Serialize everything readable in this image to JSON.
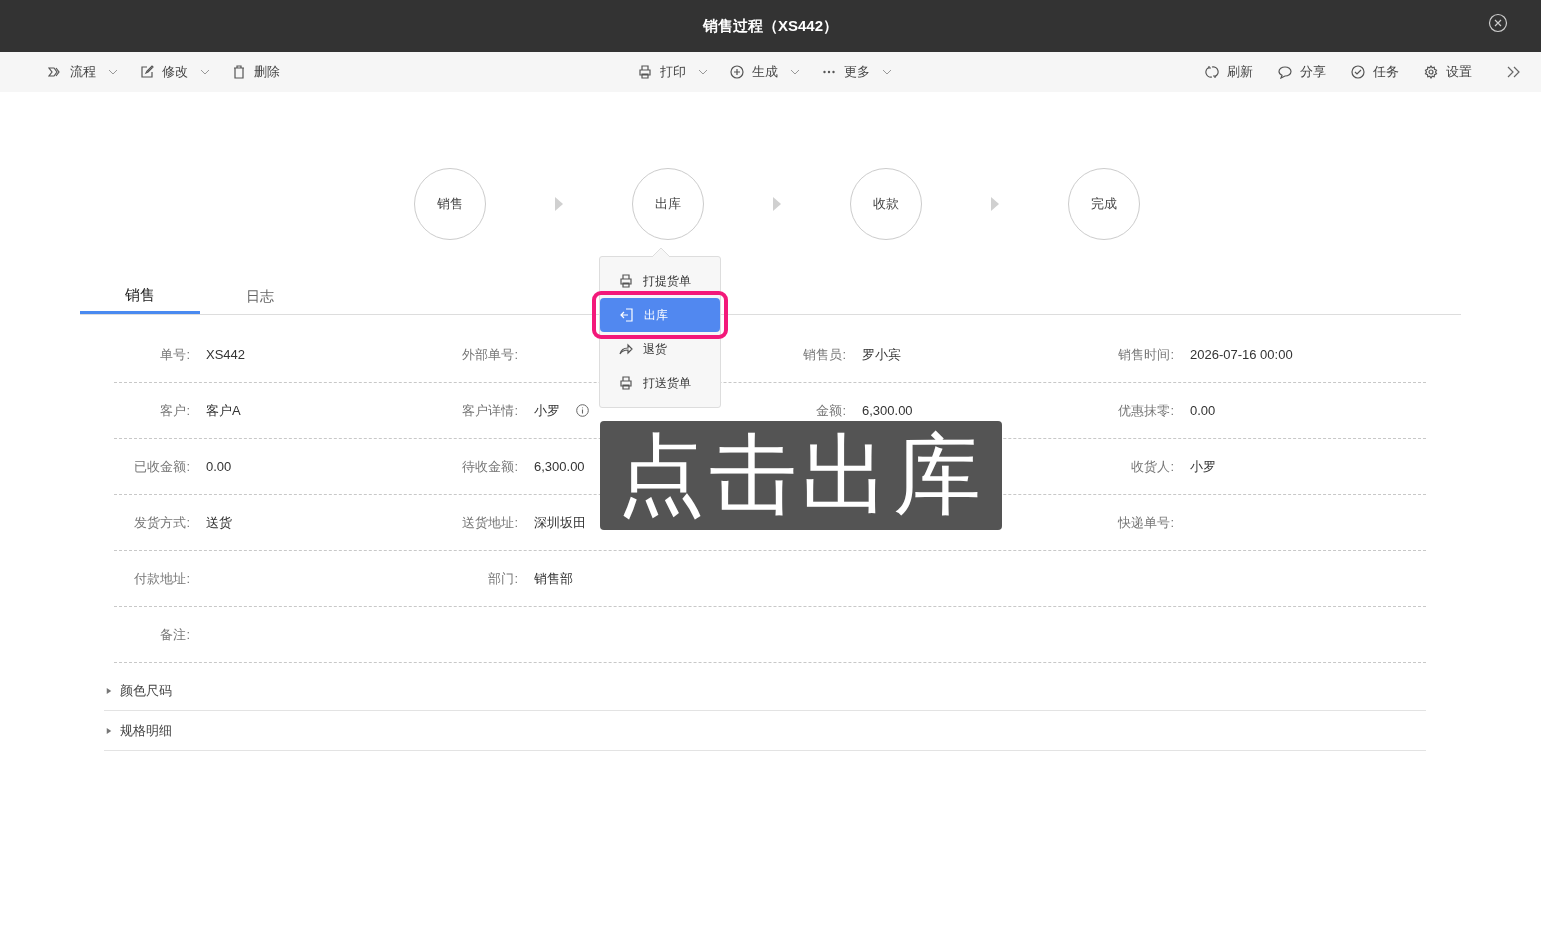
{
  "window": {
    "title": "销售过程（XS442）"
  },
  "toolbar": {
    "left": [
      {
        "kind": "flow",
        "label": "流程",
        "dropdown": true
      },
      {
        "kind": "edit",
        "label": "修改",
        "dropdown": true
      },
      {
        "kind": "trash",
        "label": "删除",
        "dropdown": false
      }
    ],
    "center": [
      {
        "kind": "print",
        "label": "打印",
        "dropdown": true
      },
      {
        "kind": "plus",
        "label": "生成",
        "dropdown": true
      },
      {
        "kind": "more",
        "label": "更多",
        "dropdown": true
      }
    ],
    "right": [
      {
        "kind": "refresh",
        "label": "刷新",
        "dropdown": false
      },
      {
        "kind": "comment",
        "label": "分享",
        "dropdown": false
      },
      {
        "kind": "check",
        "label": "任务",
        "dropdown": false
      },
      {
        "kind": "gear",
        "label": "设置",
        "dropdown": false
      }
    ]
  },
  "steps": [
    {
      "label": "销售"
    },
    {
      "label": "出库"
    },
    {
      "label": "收款"
    },
    {
      "label": "完成"
    }
  ],
  "step_menu": {
    "items": [
      {
        "kind": "print",
        "label": "打提货单",
        "selected": false
      },
      {
        "kind": "enter",
        "label": "出库",
        "selected": true
      },
      {
        "kind": "share",
        "label": "退货",
        "selected": false
      },
      {
        "kind": "print",
        "label": "打送货单",
        "selected": false
      }
    ]
  },
  "tabs": [
    {
      "label": "销售",
      "selected": true
    },
    {
      "label": "日志",
      "selected": false
    }
  ],
  "form_columns": [
    [
      {
        "label": "单号:",
        "value": "XS442"
      },
      {
        "label": "客户:",
        "value": "客户A"
      },
      {
        "label": "已收金额:",
        "value": "0.00"
      },
      {
        "label": "发货方式:",
        "value": "送货"
      },
      {
        "label": "付款地址:"
      },
      {
        "label": "备注:"
      }
    ],
    [
      {
        "label": "外部单号:"
      },
      {
        "label": "客户详情:",
        "value": "小罗",
        "info": true
      },
      {
        "label": "待收金额:",
        "value": "6,300.00"
      },
      {
        "label": "送货地址:",
        "value": "深圳坂田"
      },
      {
        "label": "部门:",
        "value": "销售部"
      }
    ],
    [
      {
        "label": "销售员:",
        "value": "罗小宾"
      },
      {
        "label": "金额:",
        "value": "6,300.00"
      }
    ],
    [
      {
        "label": "销售时间:",
        "value": "2026-07-16 00:00"
      },
      {
        "label": "优惠抹零:",
        "value": "0.00"
      },
      {
        "label": "收货人:",
        "value": "小罗"
      },
      {
        "label": "快递单号:"
      }
    ]
  ],
  "sections": [
    {
      "label": "颜色尺码",
      "expanded": false
    },
    {
      "label": "规格明细",
      "expanded": false
    }
  ],
  "callout": {
    "text": "点击出库"
  }
}
